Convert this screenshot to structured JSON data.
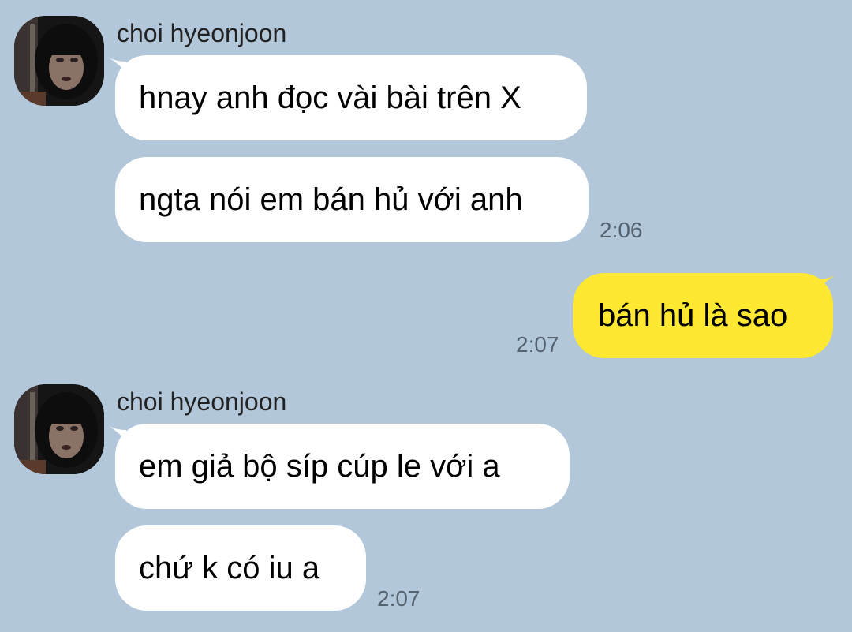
{
  "colors": {
    "background": "#b2c7da",
    "incoming_bubble": "#ffffff",
    "outgoing_bubble": "#fee832",
    "timestamp": "#556270"
  },
  "groups": [
    {
      "sender": "choi hyeonjoon",
      "avatar": "profile-photo",
      "messages": [
        {
          "text": "hnay anh đọc vài bài trên X"
        },
        {
          "text": "ngta nói em bán hủ với anh",
          "time": "2:06"
        }
      ]
    },
    {
      "outgoing": true,
      "messages": [
        {
          "text": "bán hủ là sao",
          "time": "2:07"
        }
      ]
    },
    {
      "sender": "choi hyeonjoon",
      "avatar": "profile-photo",
      "messages": [
        {
          "text": "em giả bộ síp cúp le với a"
        },
        {
          "text": "chứ k có iu a",
          "time": "2:07"
        }
      ]
    }
  ]
}
